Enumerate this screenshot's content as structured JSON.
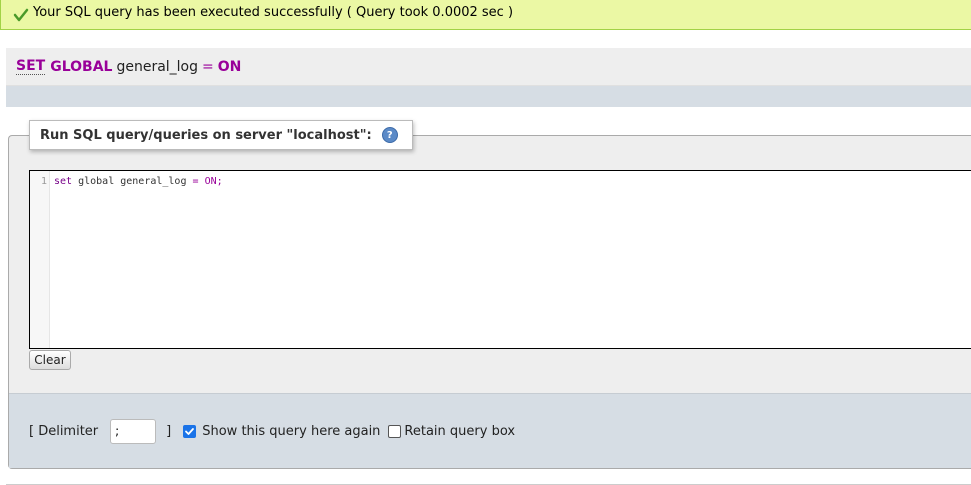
{
  "success": {
    "message": "Your SQL query has been executed successfully ( Query took 0.0002 sec )"
  },
  "executed_query": {
    "kw1": "SET",
    "kw2": "GLOBAL",
    "variable": "general_log",
    "operator": "=",
    "value": "ON"
  },
  "sql_panel": {
    "legend": "Run SQL query/queries on server \"localhost\":",
    "help_icon": "help-icon",
    "line_number": "1",
    "code_kw1": "set",
    "code_kw2": "global",
    "code_ident": "general_log",
    "code_op": "=",
    "code_value": "ON;",
    "clear_label": "Clear"
  },
  "options": {
    "delimiter_open": "[ Delimiter",
    "delimiter_value": ";",
    "delimiter_close": "]",
    "show_query_label": "Show this query here again",
    "show_query_checked": true,
    "retain_label": "Retain query box",
    "retain_checked": false
  },
  "colors": {
    "success_bg": "#ebf8a4",
    "keyword": "#990099",
    "panel_bg": "#d6dde4"
  }
}
